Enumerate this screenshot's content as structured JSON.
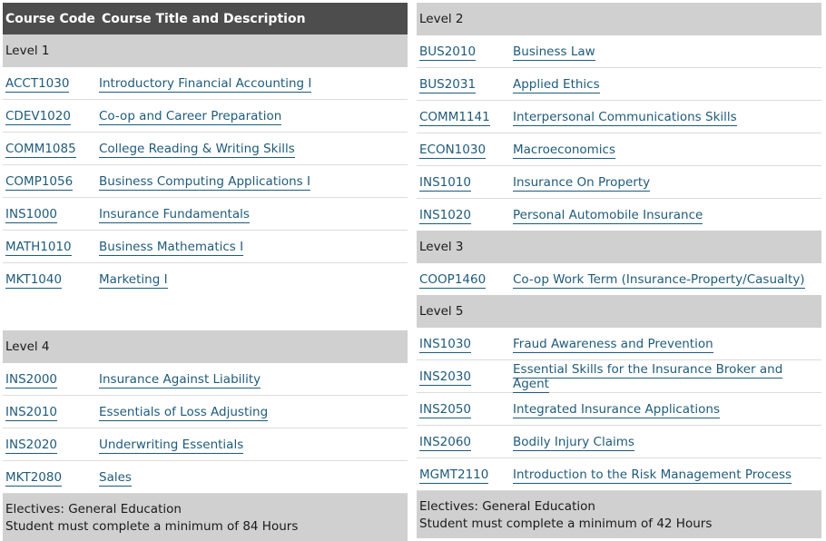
{
  "left": {
    "header": {
      "col_code": "Course Code",
      "col_title": "Course Title and Description"
    },
    "level1": {
      "label": "Level 1",
      "rows": [
        {
          "code": "ACCT1030",
          "title": "Introductory Financial Accounting I"
        },
        {
          "code": "CDEV1020",
          "title": "Co-op and Career Preparation"
        },
        {
          "code": "COMM1085",
          "title": "College Reading & Writing Skills"
        },
        {
          "code": "COMP1056",
          "title": "Business Computing Applications I"
        },
        {
          "code": "INS1000",
          "title": "Insurance Fundamentals"
        },
        {
          "code": "MATH1010",
          "title": "Business Mathematics I"
        },
        {
          "code": "MKT1040",
          "title": "Marketing I"
        }
      ]
    },
    "level4": {
      "label": "Level 4",
      "rows": [
        {
          "code": "INS2000",
          "title": "Insurance Against Liability"
        },
        {
          "code": "INS2010",
          "title": "Essentials of Loss Adjusting"
        },
        {
          "code": "INS2020",
          "title": "Underwriting Essentials"
        },
        {
          "code": "MKT2080",
          "title": "Sales"
        }
      ]
    },
    "footer": {
      "electives": "Electives: General Education",
      "hours": "Student must complete a minimum of 84 Hours"
    }
  },
  "right": {
    "level2": {
      "label": "Level 2",
      "rows": [
        {
          "code": "BUS2010",
          "title": "Business Law"
        },
        {
          "code": "BUS2031",
          "title": "Applied Ethics"
        },
        {
          "code": "COMM1141",
          "title": "Interpersonal Communications Skills"
        },
        {
          "code": "ECON1030",
          "title": "Macroeconomics"
        },
        {
          "code": "INS1010",
          "title": "Insurance On Property"
        },
        {
          "code": "INS1020",
          "title": "Personal Automobile Insurance"
        }
      ]
    },
    "level3": {
      "label": "Level 3",
      "rows": [
        {
          "code": "COOP1460",
          "title": "Co-op Work Term (Insurance-Property/Casualty)"
        }
      ]
    },
    "level5": {
      "label": "Level 5",
      "rows": [
        {
          "code": "INS1030",
          "title": "Fraud Awareness and Prevention"
        },
        {
          "code": "INS2030",
          "title": "Essential Skills for the Insurance Broker and Agent"
        },
        {
          "code": "INS2050",
          "title": "Integrated Insurance Applications"
        },
        {
          "code": "INS2060",
          "title": "Bodily Injury Claims"
        },
        {
          "code": "MGMT2110",
          "title": "Introduction to the Risk Management Process"
        }
      ]
    },
    "footer": {
      "electives": "Electives: General Education",
      "hours": "Student must complete a minimum of 42 Hours"
    }
  }
}
